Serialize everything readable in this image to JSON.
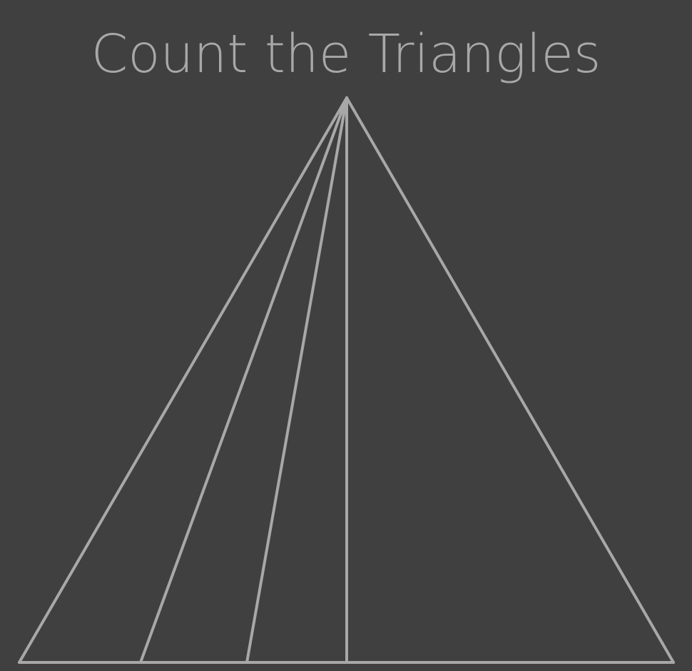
{
  "puzzle": {
    "title": "Count the Triangles",
    "colors": {
      "background": "#404040",
      "line": "#a8a8a8",
      "text": "#a8a8a8"
    }
  }
}
